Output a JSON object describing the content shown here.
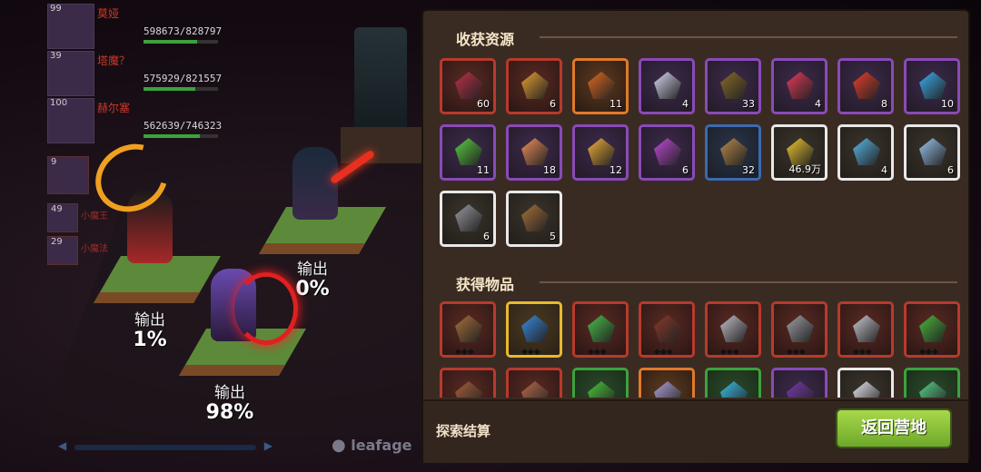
{
  "team": [
    {
      "level": "99",
      "name": "莫娅",
      "hp": "598673/828797",
      "hp_frac": 0.72
    },
    {
      "level": "39",
      "name": "塔魔？",
      "hp": "575929/821557",
      "hp_frac": 0.7
    },
    {
      "level": "100",
      "name": "赫尔塞",
      "hp": "562639/746323",
      "hp_frac": 0.75
    }
  ],
  "reserve": [
    {
      "level": "9"
    },
    {
      "level": "49",
      "name": "小魔王"
    },
    {
      "level": "29",
      "name": "小魔法"
    }
  ],
  "heroes": [
    {
      "label": "输出",
      "pct": "1%"
    },
    {
      "label": "输出",
      "pct": "0%"
    },
    {
      "label": "输出",
      "pct": "98%"
    }
  ],
  "chat": {
    "text": "leafage"
  },
  "panel": {
    "resources_title": "收获资源",
    "items_title": "获得物品",
    "settle_label": "探索结算",
    "return_label": "返回营地"
  },
  "resources": [
    {
      "icon": "dark-ore-icon",
      "count": "60",
      "rarity": "red",
      "color": "#c0304a"
    },
    {
      "icon": "flame-crest-icon",
      "count": "6",
      "rarity": "red",
      "color": "#e8a030"
    },
    {
      "icon": "coal-icon",
      "count": "11",
      "rarity": "orange",
      "color": "#e06a20"
    },
    {
      "icon": "white-crystal-icon",
      "count": "4",
      "rarity": "purple",
      "color": "#d8d8f0"
    },
    {
      "icon": "wood-branch-icon",
      "count": "33",
      "rarity": "purple",
      "color": "#8a6a2a"
    },
    {
      "icon": "red-crystal-icon",
      "count": "4",
      "rarity": "purple",
      "color": "#e83a5a"
    },
    {
      "icon": "fire-crystal-icon",
      "count": "8",
      "rarity": "purple",
      "color": "#e8402a"
    },
    {
      "icon": "blue-crystal-icon",
      "count": "10",
      "rarity": "purple",
      "color": "#3ab0f0"
    },
    {
      "icon": "green-crystal-icon",
      "count": "11",
      "rarity": "purple",
      "color": "#5ad040"
    },
    {
      "icon": "orange-crystal-icon",
      "count": "18",
      "rarity": "purple",
      "color": "#f0905a"
    },
    {
      "icon": "amber-crystal-icon",
      "count": "12",
      "rarity": "purple",
      "color": "#f0b03a"
    },
    {
      "icon": "violet-crystal-icon",
      "count": "6",
      "rarity": "purple",
      "color": "#c04ad8"
    },
    {
      "icon": "hay-bundle-icon",
      "count": "32",
      "rarity": "blue",
      "color": "#b88a4a"
    },
    {
      "icon": "gold-coin-icon",
      "count": "46.9万",
      "rarity": "white",
      "color": "#f0c830"
    },
    {
      "icon": "ice-shard-icon",
      "count": "4",
      "rarity": "white",
      "color": "#5ab8e8"
    },
    {
      "icon": "salt-pile-icon",
      "count": "6",
      "rarity": "white",
      "color": "#9ac8f0"
    },
    {
      "icon": "stone-icon",
      "count": "6",
      "rarity": "white",
      "color": "#9a9aa0"
    },
    {
      "icon": "log-pile-icon",
      "count": "5",
      "rarity": "white",
      "color": "#a8703a"
    }
  ],
  "items": [
    {
      "icon": "leather-armor-icon",
      "rarity": "red",
      "stars": "◆◆◆",
      "color": "#a8703a"
    },
    {
      "icon": "magic-staff-icon",
      "rarity": "gold",
      "stars": "◆◆◆",
      "color": "#3a8ae0"
    },
    {
      "icon": "green-wand-icon",
      "rarity": "red",
      "stars": "◆◆◆",
      "color": "#4ac04a"
    },
    {
      "icon": "bow-icon",
      "rarity": "red",
      "stars": "◆◆◆",
      "color": "#8a3a2a"
    },
    {
      "icon": "battle-axe-icon",
      "rarity": "red",
      "stars": "◆◆◆",
      "color": "#c0c0c8"
    },
    {
      "icon": "plate-armor-icon",
      "rarity": "red",
      "stars": "◆◆◆",
      "color": "#a0a0a8"
    },
    {
      "icon": "silver-amulet-icon",
      "rarity": "red",
      "stars": "◆◆◆",
      "color": "#c8c8d0"
    },
    {
      "icon": "green-amulet-icon",
      "rarity": "red",
      "stars": "◆◆◆",
      "color": "#4ab83a"
    },
    {
      "icon": "vest-icon",
      "rarity": "red",
      "stars": "",
      "color": "#a8603a"
    },
    {
      "icon": "belt-icon",
      "rarity": "red",
      "stars": "",
      "color": "#b86a4a"
    },
    {
      "icon": "green-potion-icon",
      "rarity": "green",
      "stars": "",
      "color": "#4ac83a"
    },
    {
      "icon": "purple-gem-icon",
      "rarity": "orange",
      "stars": "",
      "color": "#b0a0d8"
    },
    {
      "icon": "blue-orb-icon",
      "rarity": "green",
      "stars": "",
      "color": "#3ac0e8"
    },
    {
      "icon": "grape-icon",
      "rarity": "purple",
      "stars": "",
      "color": "#7a3ab0"
    },
    {
      "icon": "white-gem-icon",
      "rarity": "white",
      "stars": "",
      "color": "#e8e8f0"
    },
    {
      "icon": "green-flask-icon",
      "rarity": "green",
      "stars": "",
      "color": "#5ad08a"
    }
  ]
}
